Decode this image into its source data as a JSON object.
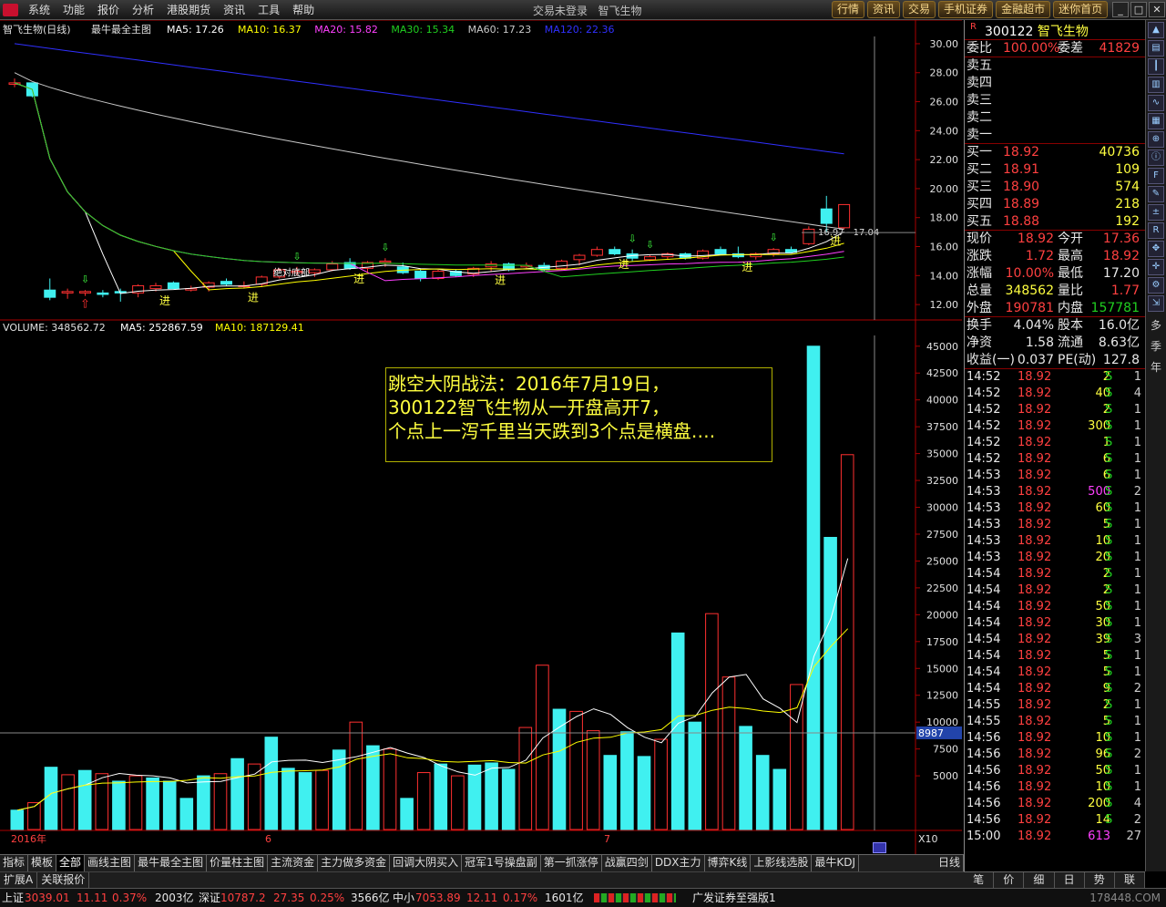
{
  "menubar": {
    "items": [
      "系统",
      "功能",
      "报价",
      "分析",
      "港股期货",
      "资讯",
      "工具",
      "帮助"
    ],
    "title_status": "交易未登录",
    "title_stock": "智飞生物",
    "buttons": [
      "行情",
      "资讯",
      "交易",
      "手机证券",
      "金融超市",
      "迷你首页"
    ]
  },
  "kline": {
    "header_name": "智飞生物(日线)",
    "header_indicator": "最牛最全主图",
    "ma_labels": [
      {
        "text": "MA5: 17.26",
        "color": "#ffffff"
      },
      {
        "text": "MA10: 16.37",
        "color": "#ffff00"
      },
      {
        "text": "MA20: 15.82",
        "color": "#ff40ff"
      },
      {
        "text": "MA30: 15.34",
        "color": "#20d020"
      },
      {
        "text": "MA60: 17.23",
        "color": "#c8c8c8"
      },
      {
        "text": "MA120: 22.36",
        "color": "#3030ff"
      }
    ],
    "y_ticks": [
      "30.00",
      "28.00",
      "26.00",
      "24.00",
      "22.00",
      "20.00",
      "18.00",
      "16.00",
      "14.00",
      "12.00"
    ],
    "y_min": 11.0,
    "y_max": 30.5,
    "candles": [
      [
        27.2,
        27.6,
        27.0,
        27.3
      ],
      [
        27.3,
        27.3,
        26.3,
        26.4
      ],
      [
        13.0,
        13.8,
        12.3,
        12.5
      ],
      [
        12.8,
        13.1,
        12.4,
        12.9
      ],
      [
        12.8,
        13.0,
        12.6,
        12.9
      ],
      [
        12.8,
        13.0,
        12.5,
        12.7
      ],
      [
        12.9,
        13.1,
        12.2,
        12.8
      ],
      [
        12.8,
        13.4,
        12.5,
        13.3
      ],
      [
        13.1,
        13.5,
        12.9,
        13.3
      ],
      [
        13.5,
        13.6,
        13.1,
        13.1
      ],
      [
        13.0,
        13.3,
        12.9,
        13.1
      ],
      [
        13.2,
        13.6,
        12.9,
        13.5
      ],
      [
        13.6,
        13.8,
        13.3,
        13.4
      ],
      [
        13.3,
        13.6,
        13.1,
        13.3
      ],
      [
        13.4,
        14.0,
        13.2,
        13.9
      ],
      [
        13.9,
        14.5,
        13.8,
        14.4
      ],
      [
        14.2,
        14.6,
        14.0,
        14.3
      ],
      [
        14.2,
        14.5,
        13.9,
        14.4
      ],
      [
        14.4,
        15.0,
        14.3,
        14.8
      ],
      [
        14.9,
        15.2,
        14.4,
        14.5
      ],
      [
        14.5,
        15.0,
        14.2,
        14.9
      ],
      [
        14.9,
        15.2,
        14.6,
        15.0
      ],
      [
        14.6,
        14.9,
        14.1,
        14.2
      ],
      [
        14.3,
        14.5,
        13.6,
        13.8
      ],
      [
        13.8,
        14.4,
        13.7,
        14.3
      ],
      [
        14.3,
        14.4,
        13.9,
        14.0
      ],
      [
        14.1,
        14.6,
        13.9,
        14.5
      ],
      [
        14.6,
        15.0,
        14.3,
        14.8
      ],
      [
        14.8,
        14.9,
        14.3,
        14.4
      ],
      [
        14.6,
        14.9,
        14.5,
        14.7
      ],
      [
        14.7,
        14.9,
        14.3,
        14.4
      ],
      [
        14.5,
        15.1,
        14.4,
        15.0
      ],
      [
        15.1,
        15.5,
        14.7,
        15.4
      ],
      [
        15.4,
        16.0,
        15.3,
        15.8
      ],
      [
        15.8,
        16.0,
        15.4,
        15.5
      ],
      [
        15.5,
        15.8,
        15.0,
        15.2
      ],
      [
        15.1,
        15.4,
        15.0,
        15.3
      ],
      [
        15.3,
        15.6,
        15.1,
        15.5
      ],
      [
        15.5,
        15.6,
        15.1,
        15.2
      ],
      [
        15.2,
        15.8,
        15.1,
        15.7
      ],
      [
        15.8,
        16.0,
        15.4,
        15.5
      ],
      [
        15.5,
        16.0,
        15.2,
        15.3
      ],
      [
        15.3,
        15.6,
        15.1,
        15.5
      ],
      [
        15.5,
        15.9,
        15.3,
        15.8
      ],
      [
        15.8,
        16.0,
        15.6,
        15.6
      ],
      [
        16.2,
        17.4,
        16.1,
        17.2
      ],
      [
        18.6,
        19.5,
        17.0,
        17.6
      ],
      [
        17.3,
        18.9,
        17.2,
        18.9
      ]
    ],
    "annotations": [
      "进",
      "进",
      "进",
      "进",
      "进",
      "进",
      "进"
    ],
    "labels": [
      "绝对底部",
      "16.97",
      "17.04"
    ]
  },
  "volume": {
    "header": "VOLUME: 348562.72",
    "ma5_label": "MA5: 252867.59",
    "ma10_label": "MA10: 187129.41",
    "y_ticks": [
      "45000",
      "42500",
      "40000",
      "37500",
      "35000",
      "32500",
      "30000",
      "27500",
      "25000",
      "22500",
      "20000",
      "17500",
      "15000",
      "12500",
      "10000",
      "7500",
      "5000"
    ],
    "cursor_value": "8987",
    "x10": "X10",
    "values": [
      1800,
      2500,
      5800,
      5100,
      5500,
      5200,
      4500,
      5000,
      4800,
      4500,
      2900,
      5000,
      5200,
      6600,
      6100,
      8600,
      5700,
      5300,
      5500,
      7400,
      10000,
      7800,
      7500,
      2900,
      5300,
      6100,
      5000,
      6000,
      6200,
      5600,
      9500,
      15300,
      11200,
      11000,
      9200,
      6900,
      9100,
      6800,
      8400,
      18300,
      10000,
      20100,
      14200,
      9600,
      6900,
      5600,
      13500,
      45000,
      27200,
      34900
    ],
    "x_labels": [
      {
        "i": 0,
        "text": "2016年"
      },
      {
        "i": 15,
        "text": "6"
      },
      {
        "i": 35,
        "text": "7"
      }
    ]
  },
  "annotation_text": {
    "line1": "跳空大阴战法：2016年7月19日，",
    "line2": "300122智飞生物从一开盘高开7，",
    "line3": "个点上一泻千里当天跌到3个点是横盘…."
  },
  "quote": {
    "code": "300122",
    "name": "智飞生物",
    "wei_bi_label": "委比",
    "wei_bi": "100.00%",
    "wei_cha_label": "委差",
    "wei_cha": "41829",
    "sells": [
      "卖五",
      "卖四",
      "卖三",
      "卖二",
      "卖一"
    ],
    "buys": [
      {
        "label": "买一",
        "price": "18.92",
        "vol": "40736"
      },
      {
        "label": "买二",
        "price": "18.91",
        "vol": "109"
      },
      {
        "label": "买三",
        "price": "18.90",
        "vol": "574"
      },
      {
        "label": "买四",
        "price": "18.89",
        "vol": "218"
      },
      {
        "label": "买五",
        "price": "18.88",
        "vol": "192"
      }
    ],
    "stats": [
      {
        "l1": "现价",
        "v1": "18.92",
        "c1": "red",
        "l2": "今开",
        "v2": "17.36",
        "c2": "red"
      },
      {
        "l1": "涨跌",
        "v1": "1.72",
        "c1": "red",
        "l2": "最高",
        "v2": "18.92",
        "c2": "red"
      },
      {
        "l1": "涨幅",
        "v1": "10.00%",
        "c1": "red",
        "l2": "最低",
        "v2": "17.20",
        "c2": "wht"
      },
      {
        "l1": "总量",
        "v1": "348562",
        "c1": "yel",
        "l2": "量比",
        "v2": "1.77",
        "c2": "red"
      },
      {
        "l1": "外盘",
        "v1": "190781",
        "c1": "red",
        "l2": "内盘",
        "v2": "157781",
        "c2": "grn"
      }
    ],
    "stats2": [
      {
        "l1": "换手",
        "v1": "4.04%",
        "l2": "股本",
        "v2": "16.0亿"
      },
      {
        "l1": "净资",
        "v1": "1.58",
        "l2": "流通",
        "v2": "8.63亿"
      },
      {
        "l1": "收益(一)",
        "v1": "0.037",
        "l2": "PE(动)",
        "v2": "127.8"
      }
    ]
  },
  "ticks": [
    [
      "14:52",
      "18.92",
      "2",
      "S",
      "1"
    ],
    [
      "14:52",
      "18.92",
      "40",
      "S",
      "4"
    ],
    [
      "14:52",
      "18.92",
      "2",
      "S",
      "1"
    ],
    [
      "14:52",
      "18.92",
      "300",
      "S",
      "1"
    ],
    [
      "14:52",
      "18.92",
      "1",
      "S",
      "1"
    ],
    [
      "14:52",
      "18.92",
      "6",
      "S",
      "1"
    ],
    [
      "14:53",
      "18.92",
      "6",
      "S",
      "1"
    ],
    [
      "14:53",
      "18.92",
      "500",
      "S",
      "2"
    ],
    [
      "14:53",
      "18.92",
      "60",
      "S",
      "1"
    ],
    [
      "14:53",
      "18.92",
      "5",
      "S",
      "1"
    ],
    [
      "14:53",
      "18.92",
      "10",
      "S",
      "1"
    ],
    [
      "14:53",
      "18.92",
      "20",
      "S",
      "1"
    ],
    [
      "14:54",
      "18.92",
      "2",
      "S",
      "1"
    ],
    [
      "14:54",
      "18.92",
      "2",
      "S",
      "1"
    ],
    [
      "14:54",
      "18.92",
      "50",
      "S",
      "1"
    ],
    [
      "14:54",
      "18.92",
      "30",
      "S",
      "1"
    ],
    [
      "14:54",
      "18.92",
      "39",
      "S",
      "3"
    ],
    [
      "14:54",
      "18.92",
      "5",
      "S",
      "1"
    ],
    [
      "14:54",
      "18.92",
      "5",
      "S",
      "1"
    ],
    [
      "14:54",
      "18.92",
      "9",
      "S",
      "2"
    ],
    [
      "14:55",
      "18.92",
      "2",
      "S",
      "1"
    ],
    [
      "14:55",
      "18.92",
      "5",
      "S",
      "1"
    ],
    [
      "14:56",
      "18.92",
      "10",
      "S",
      "1"
    ],
    [
      "14:56",
      "18.92",
      "96",
      "S",
      "2"
    ],
    [
      "14:56",
      "18.92",
      "50",
      "S",
      "1"
    ],
    [
      "14:56",
      "18.92",
      "10",
      "S",
      "1"
    ],
    [
      "14:56",
      "18.92",
      "200",
      "S",
      "4"
    ],
    [
      "14:56",
      "18.92",
      "14",
      "S",
      "2"
    ],
    [
      "15:00",
      "18.92",
      "613",
      "",
      "27"
    ]
  ],
  "tabs": [
    "指标",
    "模板",
    "全部",
    "画线主图",
    "最牛最全主图",
    "价量柱主图",
    "主流资金",
    "主力做多资金",
    "回调大阴买入",
    "冠军1号操盘副",
    "第一抓涨停",
    "战赢四剑",
    "DDX主力",
    "博弈K线",
    "上影线选股",
    "最牛KDJ"
  ],
  "subtabs": [
    "扩展A",
    "关联报价"
  ],
  "period_label": "日线",
  "right_tabs": [
    "笔",
    "价",
    "细",
    "日",
    "势",
    "联"
  ],
  "right_side_labels": [
    "多",
    "季",
    "年"
  ],
  "status": {
    "sh_label": "上证",
    "sh_index": "3039.01",
    "sh_chg": "11.11",
    "sh_pct": "0.37%",
    "sh_amt": "2003亿",
    "sz_label": "深证",
    "sz_index": "10787.2",
    "sz_chg": "27.35",
    "sz_pct": "0.25%",
    "sz_amt": "3566亿",
    "zx_label": "中小",
    "zx_index": "7053.89",
    "zx_chg": "12.11",
    "zx_pct": "0.17%",
    "zx_amt": "1601亿",
    "broker": "广发证券至强版1",
    "watermark": "178448.COM"
  }
}
